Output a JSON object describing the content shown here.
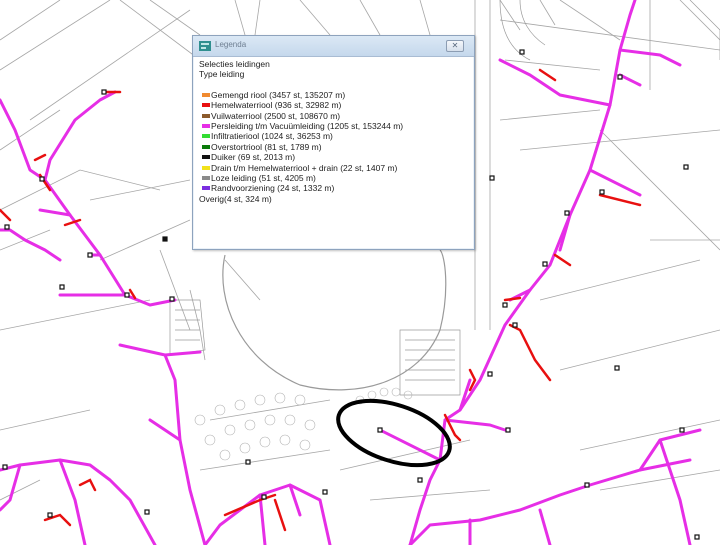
{
  "legend": {
    "title": "Legenda",
    "close_symbol": "✕",
    "heading1": "Selecties leidingen",
    "heading2": "Type leiding",
    "items": [
      {
        "label": "Gemengd riool (3457 st, 135207 m)",
        "color": "#f08a30"
      },
      {
        "label": "Hemelwaterriool (936 st, 32982 m)",
        "color": "#e81010"
      },
      {
        "label": "Vuilwaterriool (2500 st, 108670 m)",
        "color": "#8b5a2b"
      },
      {
        "label": "Persleiding t/m Vacuümleiding (1205 st, 153244 m)",
        "color": "#e62ee6"
      },
      {
        "label": "Infiltratieriool (1024 st, 36253 m)",
        "color": "#33dd33"
      },
      {
        "label": "Overstortriool (81 st, 1789 m)",
        "color": "#0a7a0a"
      },
      {
        "label": "Duiker (69 st, 2013 m)",
        "color": "#111111"
      },
      {
        "label": "Drain t/m Hemelwaterriool + drain (22 st, 1407 m)",
        "color": "#f2e21a"
      },
      {
        "label": "Loze leiding (51 st, 4205 m)",
        "color": "#8a8a8a"
      },
      {
        "label": "Randvoorziening (24 st, 1332 m)",
        "color": "#7a2ee0"
      }
    ],
    "overig": "Overig(4 st, 324 m)"
  },
  "colors": {
    "persleiding": "#e62ee6",
    "hemelwater": "#e81010",
    "background_line": "#a6a6a6",
    "highlight_ellipse": "#000000"
  },
  "icons": {
    "node": "manhole-node-icon",
    "legend_app": "legend-app-icon",
    "close": "close-icon"
  }
}
